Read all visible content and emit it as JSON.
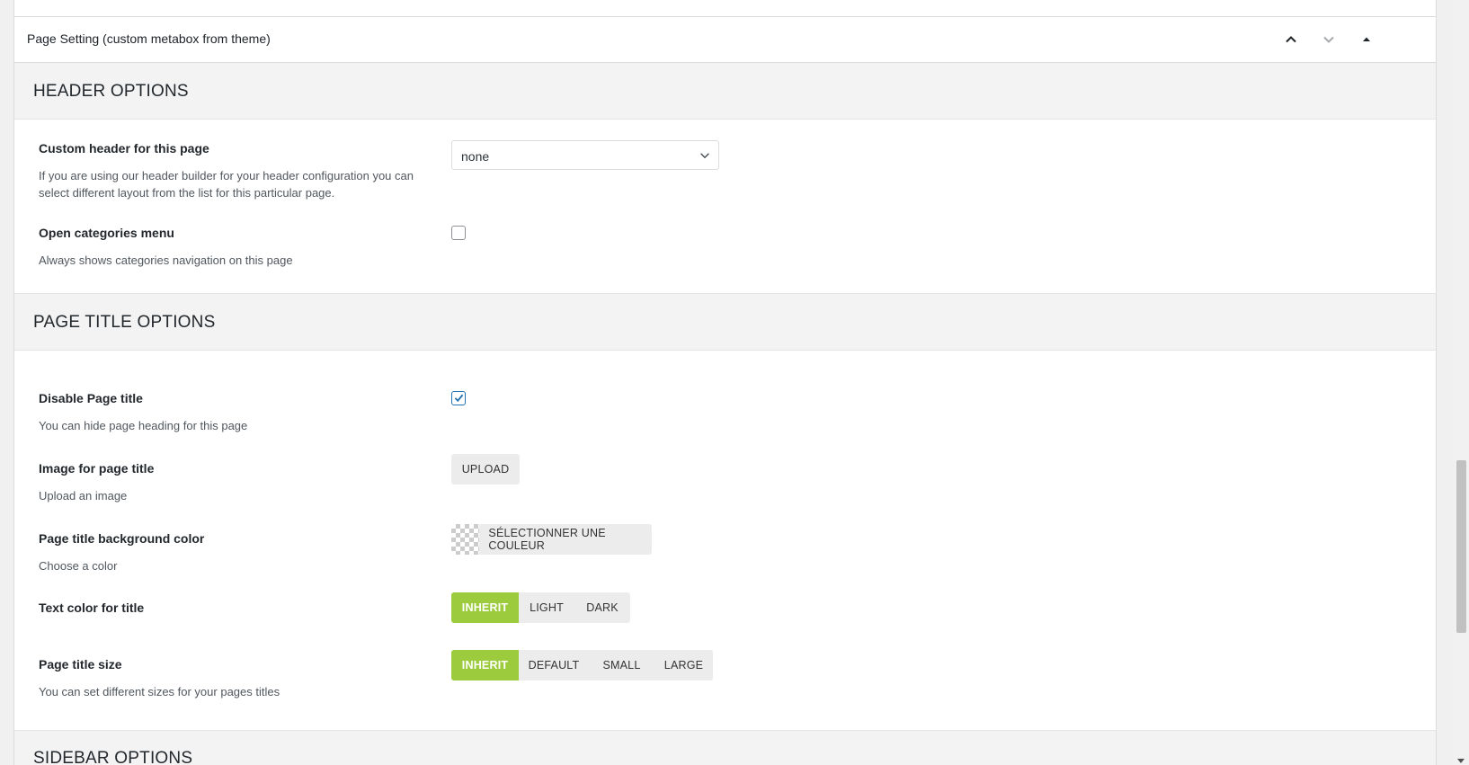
{
  "metabox": {
    "title": "Page Setting (custom metabox from theme)"
  },
  "sections": {
    "header": {
      "title": "HEADER OPTIONS",
      "custom_header": {
        "label": "Custom header for this page",
        "description": "If you are using our header builder for your header configuration you can select different layout from the list for this particular page.",
        "selected": "none"
      },
      "open_categories": {
        "label": "Open categories menu",
        "description": "Always shows categories navigation on this page",
        "checked": false
      }
    },
    "page_title": {
      "title": "PAGE TITLE OPTIONS",
      "disable_title": {
        "label": "Disable Page title",
        "description": "You can hide page heading for this page",
        "checked": true
      },
      "image": {
        "label": "Image for page title",
        "description": "Upload an image",
        "button": "UPLOAD"
      },
      "bg_color": {
        "label": "Page title background color",
        "description": "Choose a color",
        "button": "SÉLECTIONNER UNE COULEUR"
      },
      "text_color": {
        "label": "Text color for title",
        "options": [
          "INHERIT",
          "LIGHT",
          "DARK"
        ],
        "selected": "INHERIT"
      },
      "size": {
        "label": "Page title size",
        "description": "You can set different sizes for your pages titles",
        "options": [
          "INHERIT",
          "DEFAULT",
          "SMALL",
          "LARGE"
        ],
        "selected": "INHERIT"
      }
    },
    "sidebar": {
      "title": "SIDEBAR OPTIONS"
    }
  },
  "colors": {
    "accent_active": "#9ccc3d",
    "checkbox_check": "#2271b1"
  }
}
